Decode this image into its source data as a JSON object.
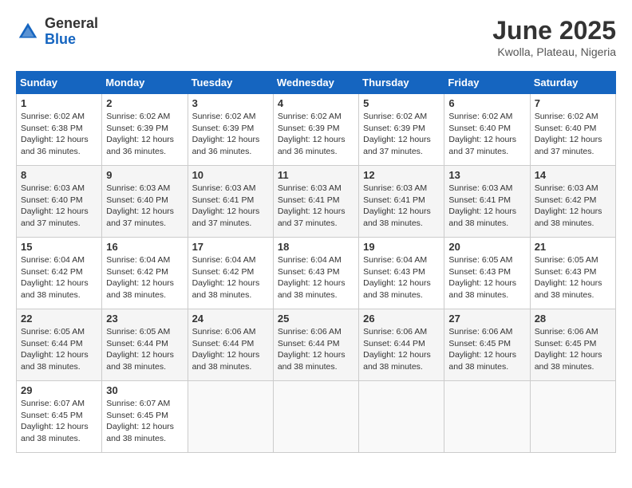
{
  "header": {
    "logo_general": "General",
    "logo_blue": "Blue",
    "month_title": "June 2025",
    "location": "Kwolla, Plateau, Nigeria"
  },
  "days_of_week": [
    "Sunday",
    "Monday",
    "Tuesday",
    "Wednesday",
    "Thursday",
    "Friday",
    "Saturday"
  ],
  "weeks": [
    [
      {
        "day": 1,
        "sunrise": "6:02 AM",
        "sunset": "6:38 PM",
        "daylight": "12 hours and 36 minutes."
      },
      {
        "day": 2,
        "sunrise": "6:02 AM",
        "sunset": "6:39 PM",
        "daylight": "12 hours and 36 minutes."
      },
      {
        "day": 3,
        "sunrise": "6:02 AM",
        "sunset": "6:39 PM",
        "daylight": "12 hours and 36 minutes."
      },
      {
        "day": 4,
        "sunrise": "6:02 AM",
        "sunset": "6:39 PM",
        "daylight": "12 hours and 36 minutes."
      },
      {
        "day": 5,
        "sunrise": "6:02 AM",
        "sunset": "6:39 PM",
        "daylight": "12 hours and 37 minutes."
      },
      {
        "day": 6,
        "sunrise": "6:02 AM",
        "sunset": "6:40 PM",
        "daylight": "12 hours and 37 minutes."
      },
      {
        "day": 7,
        "sunrise": "6:02 AM",
        "sunset": "6:40 PM",
        "daylight": "12 hours and 37 minutes."
      }
    ],
    [
      {
        "day": 8,
        "sunrise": "6:03 AM",
        "sunset": "6:40 PM",
        "daylight": "12 hours and 37 minutes."
      },
      {
        "day": 9,
        "sunrise": "6:03 AM",
        "sunset": "6:40 PM",
        "daylight": "12 hours and 37 minutes."
      },
      {
        "day": 10,
        "sunrise": "6:03 AM",
        "sunset": "6:41 PM",
        "daylight": "12 hours and 37 minutes."
      },
      {
        "day": 11,
        "sunrise": "6:03 AM",
        "sunset": "6:41 PM",
        "daylight": "12 hours and 37 minutes."
      },
      {
        "day": 12,
        "sunrise": "6:03 AM",
        "sunset": "6:41 PM",
        "daylight": "12 hours and 38 minutes."
      },
      {
        "day": 13,
        "sunrise": "6:03 AM",
        "sunset": "6:41 PM",
        "daylight": "12 hours and 38 minutes."
      },
      {
        "day": 14,
        "sunrise": "6:03 AM",
        "sunset": "6:42 PM",
        "daylight": "12 hours and 38 minutes."
      }
    ],
    [
      {
        "day": 15,
        "sunrise": "6:04 AM",
        "sunset": "6:42 PM",
        "daylight": "12 hours and 38 minutes."
      },
      {
        "day": 16,
        "sunrise": "6:04 AM",
        "sunset": "6:42 PM",
        "daylight": "12 hours and 38 minutes."
      },
      {
        "day": 17,
        "sunrise": "6:04 AM",
        "sunset": "6:42 PM",
        "daylight": "12 hours and 38 minutes."
      },
      {
        "day": 18,
        "sunrise": "6:04 AM",
        "sunset": "6:43 PM",
        "daylight": "12 hours and 38 minutes."
      },
      {
        "day": 19,
        "sunrise": "6:04 AM",
        "sunset": "6:43 PM",
        "daylight": "12 hours and 38 minutes."
      },
      {
        "day": 20,
        "sunrise": "6:05 AM",
        "sunset": "6:43 PM",
        "daylight": "12 hours and 38 minutes."
      },
      {
        "day": 21,
        "sunrise": "6:05 AM",
        "sunset": "6:43 PM",
        "daylight": "12 hours and 38 minutes."
      }
    ],
    [
      {
        "day": 22,
        "sunrise": "6:05 AM",
        "sunset": "6:44 PM",
        "daylight": "12 hours and 38 minutes."
      },
      {
        "day": 23,
        "sunrise": "6:05 AM",
        "sunset": "6:44 PM",
        "daylight": "12 hours and 38 minutes."
      },
      {
        "day": 24,
        "sunrise": "6:06 AM",
        "sunset": "6:44 PM",
        "daylight": "12 hours and 38 minutes."
      },
      {
        "day": 25,
        "sunrise": "6:06 AM",
        "sunset": "6:44 PM",
        "daylight": "12 hours and 38 minutes."
      },
      {
        "day": 26,
        "sunrise": "6:06 AM",
        "sunset": "6:44 PM",
        "daylight": "12 hours and 38 minutes."
      },
      {
        "day": 27,
        "sunrise": "6:06 AM",
        "sunset": "6:45 PM",
        "daylight": "12 hours and 38 minutes."
      },
      {
        "day": 28,
        "sunrise": "6:06 AM",
        "sunset": "6:45 PM",
        "daylight": "12 hours and 38 minutes."
      }
    ],
    [
      {
        "day": 29,
        "sunrise": "6:07 AM",
        "sunset": "6:45 PM",
        "daylight": "12 hours and 38 minutes."
      },
      {
        "day": 30,
        "sunrise": "6:07 AM",
        "sunset": "6:45 PM",
        "daylight": "12 hours and 38 minutes."
      },
      null,
      null,
      null,
      null,
      null
    ]
  ]
}
